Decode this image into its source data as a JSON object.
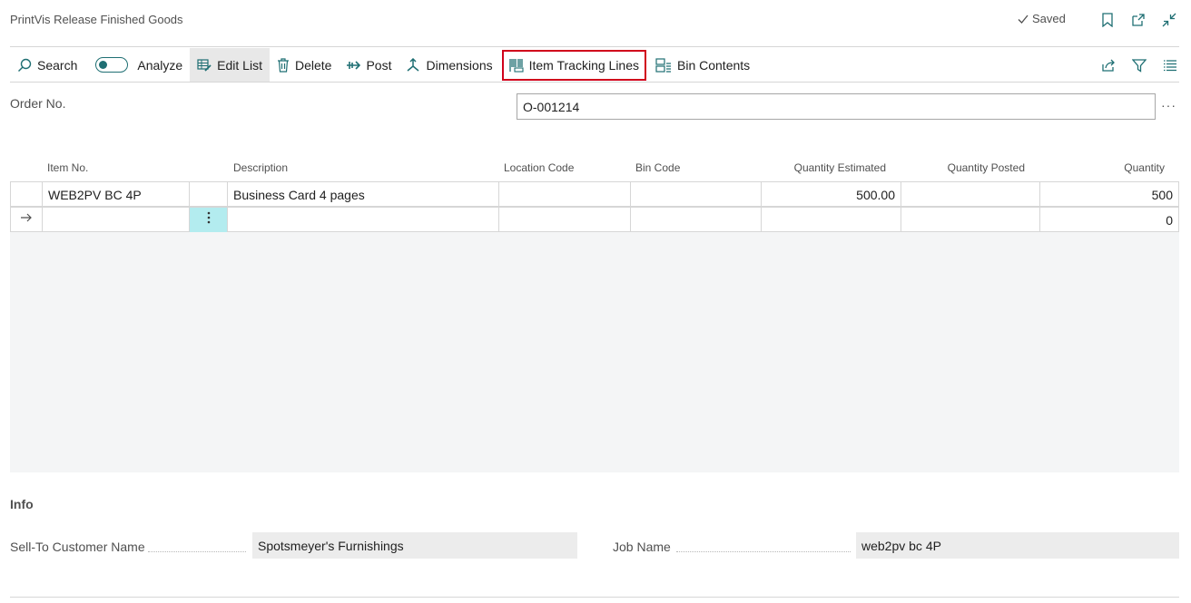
{
  "header": {
    "title": "PrintVis Release Finished Goods",
    "status": "Saved"
  },
  "actions": {
    "search": "Search",
    "analyze": "Analyze",
    "edit_list": "Edit List",
    "delete": "Delete",
    "post": "Post",
    "dimensions": "Dimensions",
    "item_tracking_lines": "Item Tracking Lines",
    "bin_contents": "Bin Contents"
  },
  "order": {
    "label": "Order No.",
    "value": "O-001214"
  },
  "grid": {
    "columns": [
      "Item No.",
      "Description",
      "Location Code",
      "Bin Code",
      "Quantity Estimated",
      "Quantity Posted",
      "Quantity"
    ],
    "rows": [
      {
        "item_no": "WEB2PV BC 4P",
        "description": "Business Card 4 pages",
        "location_code": "",
        "bin_code": "",
        "quantity_estimated": "500.00",
        "quantity_posted": "",
        "quantity": "500"
      },
      {
        "item_no": "",
        "description": "",
        "location_code": "",
        "bin_code": "",
        "quantity_estimated": "",
        "quantity_posted": "",
        "quantity": "0"
      }
    ]
  },
  "info": {
    "title": "Info",
    "sell_to_label": "Sell-To Customer Name",
    "sell_to_value": "Spotsmeyer's Furnishings",
    "job_name_label": "Job Name",
    "job_name_value": "web2pv bc 4P"
  },
  "colors": {
    "accent": "#1f6f73",
    "highlight_border": "#d0021b",
    "selected_cell": "#b3ecef"
  }
}
